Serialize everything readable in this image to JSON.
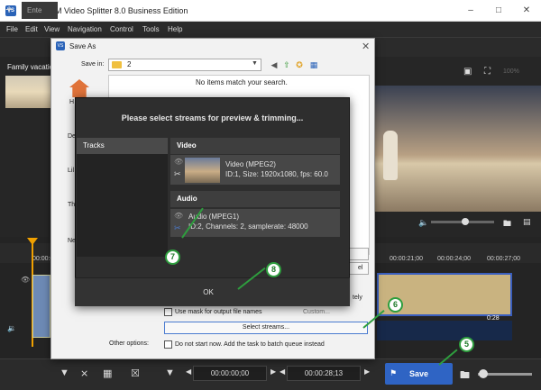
{
  "window": {
    "title": "SolveigMM Video Splitter 8.0 Business Edition",
    "logo_text": "VS"
  },
  "menu": [
    "File",
    "Edit",
    "View",
    "Navigation",
    "Control",
    "Tools",
    "Help"
  ],
  "tabs": {
    "add": "+",
    "entered": "Ente"
  },
  "project": {
    "name": "Family vacatio"
  },
  "preview": {
    "zoom": "100%"
  },
  "timeline": {
    "ticks": [
      "00:00:21;00",
      "00:00:24;00",
      "00:00:27;00"
    ],
    "left_tick": "00:00:0",
    "clip_time": "0:28"
  },
  "toolbar": {
    "start_time": "00:00:00;00",
    "end_time": "00:00:28;13",
    "save_label": "Save"
  },
  "save_dialog": {
    "title": "Save As",
    "logo_text": "VS",
    "save_in_label": "Save in:",
    "save_in_value": "2",
    "no_items": "No items match your search.",
    "places": [
      "H",
      "De",
      "Lil",
      "Th",
      "Ne"
    ],
    "btn2_label": "el",
    "lately": "tely",
    "mask_label": "Use mask for output file names",
    "custom_label": "Custom...",
    "select_streams": "Select streams...",
    "other_options": "Other options:",
    "nostart_label": "Do not start now. Add the task to batch queue instead"
  },
  "streams_dialog": {
    "title": "Please select streams for preview & trimming...",
    "tracks_header": "Tracks",
    "video_header": "Video",
    "video_name": "Video (MPEG2)",
    "video_info": "ID:1, Size: 1920x1080, fps: 60.0",
    "audio_header": "Audio",
    "audio_name": "Audio (MPEG1)",
    "audio_info": "ID:2, Channels: 2, samplerate: 48000",
    "ok_label": "OK"
  },
  "callouts": [
    "5",
    "6",
    "7",
    "8"
  ],
  "colors": {
    "accent": "#2f64c4",
    "callout": "#2e9e3e",
    "playhead": "#f0a000"
  }
}
